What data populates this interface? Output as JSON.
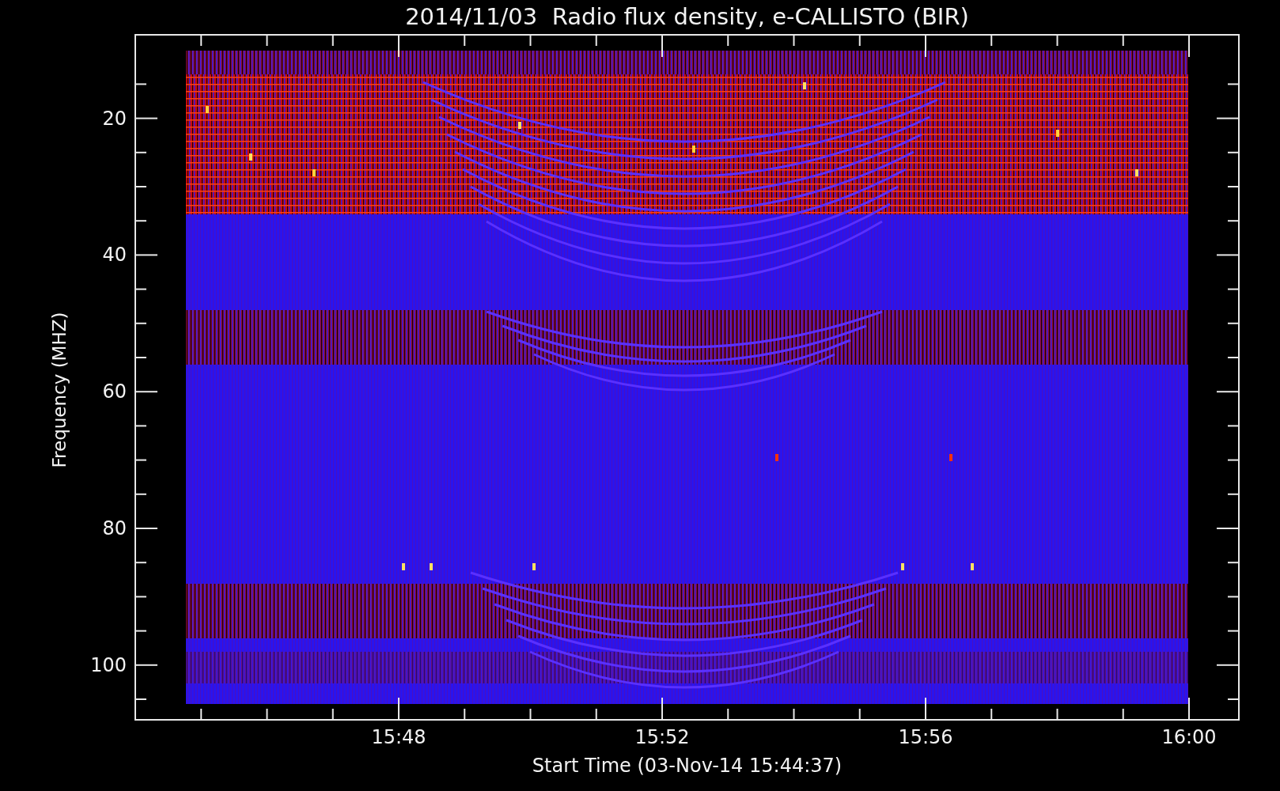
{
  "title": "2014/11/03  Radio flux density, e-CALLISTO (BIR)",
  "y_axis": {
    "label": "Frequency (MHZ)",
    "ticks": [
      "20",
      "40",
      "60",
      "80",
      "100"
    ]
  },
  "x_axis": {
    "label": "Start Time (03-Nov-14 15:44:37)",
    "ticks": [
      "15:48",
      "15:52",
      "15:56",
      "16:00"
    ]
  }
}
